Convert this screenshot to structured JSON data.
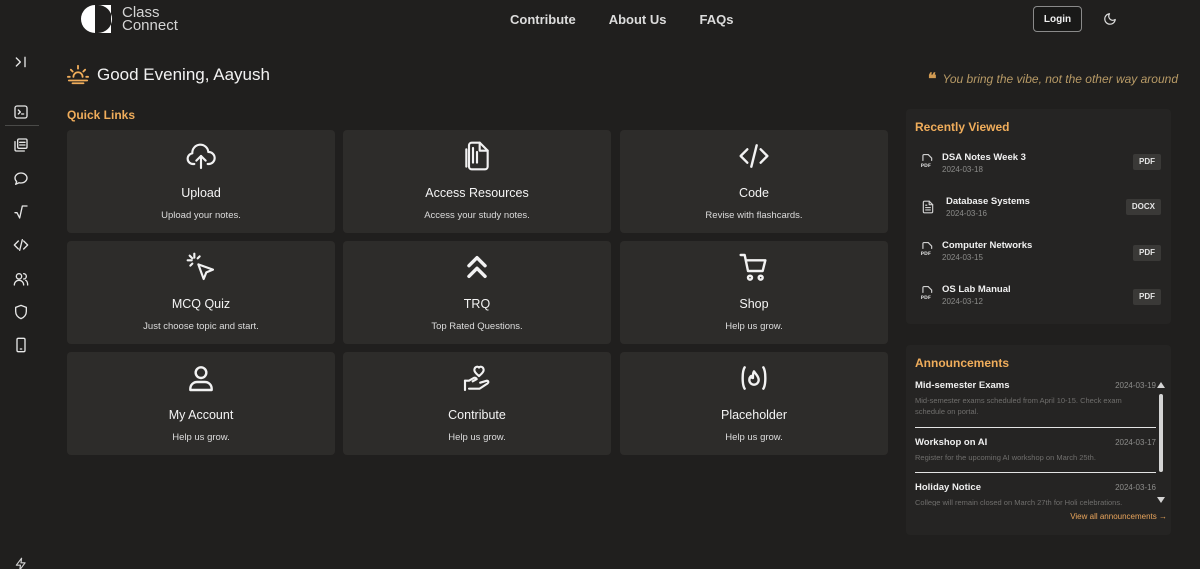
{
  "header": {
    "logo_line1": "Class",
    "logo_line2": "Connect",
    "nav": [
      "Contribute",
      "About Us",
      "FAQs"
    ],
    "login_label": "Login"
  },
  "greeting": {
    "text": "Good Evening, Aayush"
  },
  "quote": {
    "text": "You bring the vibe, not the other way around"
  },
  "quick_links": {
    "title": "Quick Links",
    "cards": [
      {
        "title": "Upload",
        "desc": "Upload your notes.",
        "icon": "cloud-upload-icon"
      },
      {
        "title": "Access Resources",
        "desc": "Access your study notes.",
        "icon": "document-icon"
      },
      {
        "title": "Code",
        "desc": "Revise with flashcards.",
        "icon": "code-icon"
      },
      {
        "title": "MCQ Quiz",
        "desc": "Just choose topic and start.",
        "icon": "pointer-click-icon"
      },
      {
        "title": "TRQ",
        "desc": "Top Rated Questions.",
        "icon": "chevrons-up-icon"
      },
      {
        "title": "Shop",
        "desc": "Help us grow.",
        "icon": "cart-icon"
      },
      {
        "title": "My Account",
        "desc": "Help us grow.",
        "icon": "user-icon"
      },
      {
        "title": "Contribute",
        "desc": "Help us grow.",
        "icon": "hand-heart-icon"
      },
      {
        "title": "Placeholder",
        "desc": "Help us grow.",
        "icon": "fire-icon"
      }
    ]
  },
  "recently_viewed": {
    "title": "Recently Viewed",
    "items": [
      {
        "name": "DSA Notes Week 3",
        "date": "2024-03-18",
        "type": "PDF"
      },
      {
        "name": "Database Systems",
        "date": "2024-03-16",
        "type": "DOCX"
      },
      {
        "name": "Computer Networks",
        "date": "2024-03-15",
        "type": "PDF"
      },
      {
        "name": "OS Lab Manual",
        "date": "2024-03-12",
        "type": "PDF"
      }
    ]
  },
  "announcements": {
    "title": "Announcements",
    "items": [
      {
        "title": "Mid-semester Exams",
        "date": "2024-03-19",
        "body": "Mid-semester exams scheduled from April 10-15. Check exam schedule on portal."
      },
      {
        "title": "Workshop on AI",
        "date": "2024-03-17",
        "body": "Register for the upcoming AI workshop on March 25th."
      },
      {
        "title": "Holiday Notice",
        "date": "2024-03-16",
        "body": "College will remain closed on March 27th for Holi celebrations."
      }
    ],
    "view_all": "View all announcements →"
  },
  "sidebar": {
    "icons": [
      "expand-icon",
      "terminal-icon",
      "notes-icon",
      "chat-icon",
      "sqrt-icon",
      "code-icon",
      "users-icon",
      "shield-icon",
      "phone-icon"
    ]
  },
  "colors": {
    "background": "#201f1e",
    "card": "#2d2c2a",
    "accent": "#f0ad5b"
  }
}
